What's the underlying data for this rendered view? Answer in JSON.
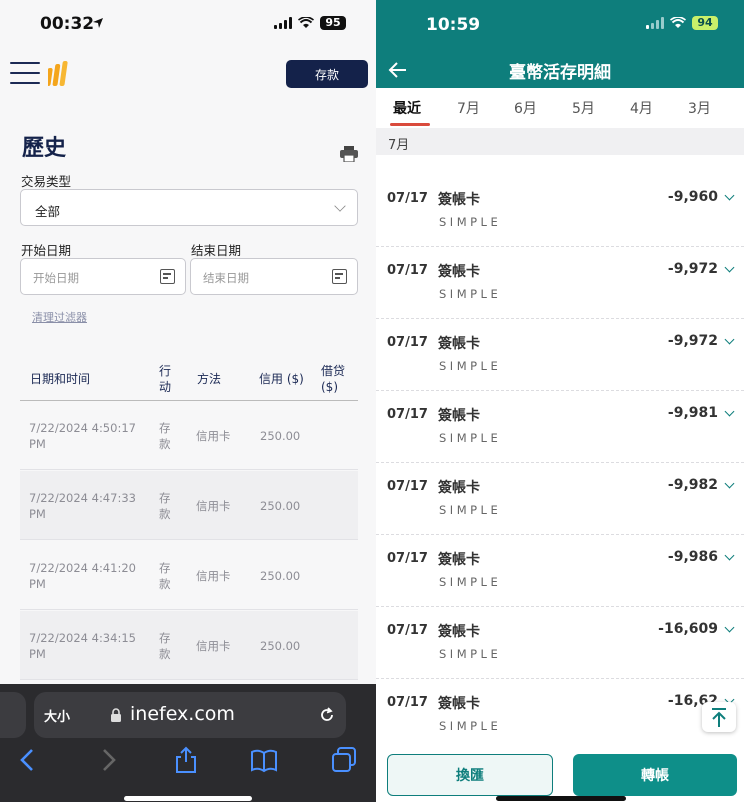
{
  "left": {
    "status": {
      "time": "00:32",
      "battery": "95"
    },
    "header": {
      "deposit_label": "存款"
    },
    "page": {
      "title": "歷史"
    },
    "filters": {
      "type_label": "交易类型",
      "type_value": "全部",
      "start_label": "开始日期",
      "start_placeholder": "开始日期",
      "end_label": "结束日期",
      "end_placeholder": "结束日期",
      "clear_label": "清理过滤器"
    },
    "table": {
      "headers": [
        "日期和时间",
        "行动",
        "方法",
        "信用 ($)",
        "借贷 ($)"
      ],
      "rows": [
        {
          "date": "7/22/2024 4:50:17",
          "time_suffix": "PM",
          "action": "存款",
          "method": "信用卡",
          "credit": "250.00"
        },
        {
          "date": "7/22/2024 4:47:33",
          "time_suffix": "PM",
          "action": "存款",
          "method": "信用卡",
          "credit": "250.00"
        },
        {
          "date": "7/22/2024 4:41:20",
          "time_suffix": "PM",
          "action": "存款",
          "method": "信用卡",
          "credit": "250.00"
        },
        {
          "date": "7/22/2024 4:34:15",
          "time_suffix": "PM",
          "action": "存款",
          "method": "信用卡",
          "credit": "250.00"
        }
      ]
    },
    "browser": {
      "aa_label": "大小",
      "url": "inefex.com"
    }
  },
  "right": {
    "status": {
      "time": "10:59",
      "battery": "94"
    },
    "title": "臺幣活存明細",
    "tabs": [
      "最近",
      "7月",
      "6月",
      "5月",
      "4月",
      "3月"
    ],
    "month_header": "7月",
    "transactions": [
      {
        "date": "07/17",
        "desc": "簽帳卡",
        "sub": "SIMPLE",
        "amount": "-9,960"
      },
      {
        "date": "07/17",
        "desc": "簽帳卡",
        "sub": "SIMPLE",
        "amount": "-9,972"
      },
      {
        "date": "07/17",
        "desc": "簽帳卡",
        "sub": "SIMPLE",
        "amount": "-9,972"
      },
      {
        "date": "07/17",
        "desc": "簽帳卡",
        "sub": "SIMPLE",
        "amount": "-9,981"
      },
      {
        "date": "07/17",
        "desc": "簽帳卡",
        "sub": "SIMPLE",
        "amount": "-9,982"
      },
      {
        "date": "07/17",
        "desc": "簽帳卡",
        "sub": "SIMPLE",
        "amount": "-9,986"
      },
      {
        "date": "07/17",
        "desc": "簽帳卡",
        "sub": "SIMPLE",
        "amount": "-16,609"
      },
      {
        "date": "07/17",
        "desc": "簽帳卡",
        "sub": "SIMPLE",
        "amount": "-16,62"
      }
    ],
    "buttons": {
      "exchange": "換匯",
      "transfer": "轉帳"
    }
  },
  "colors": {
    "navy": "#14224a",
    "teal": "#0e7e7c",
    "accent_red": "#d94a3c",
    "logo_orange": "#f4a51c"
  }
}
